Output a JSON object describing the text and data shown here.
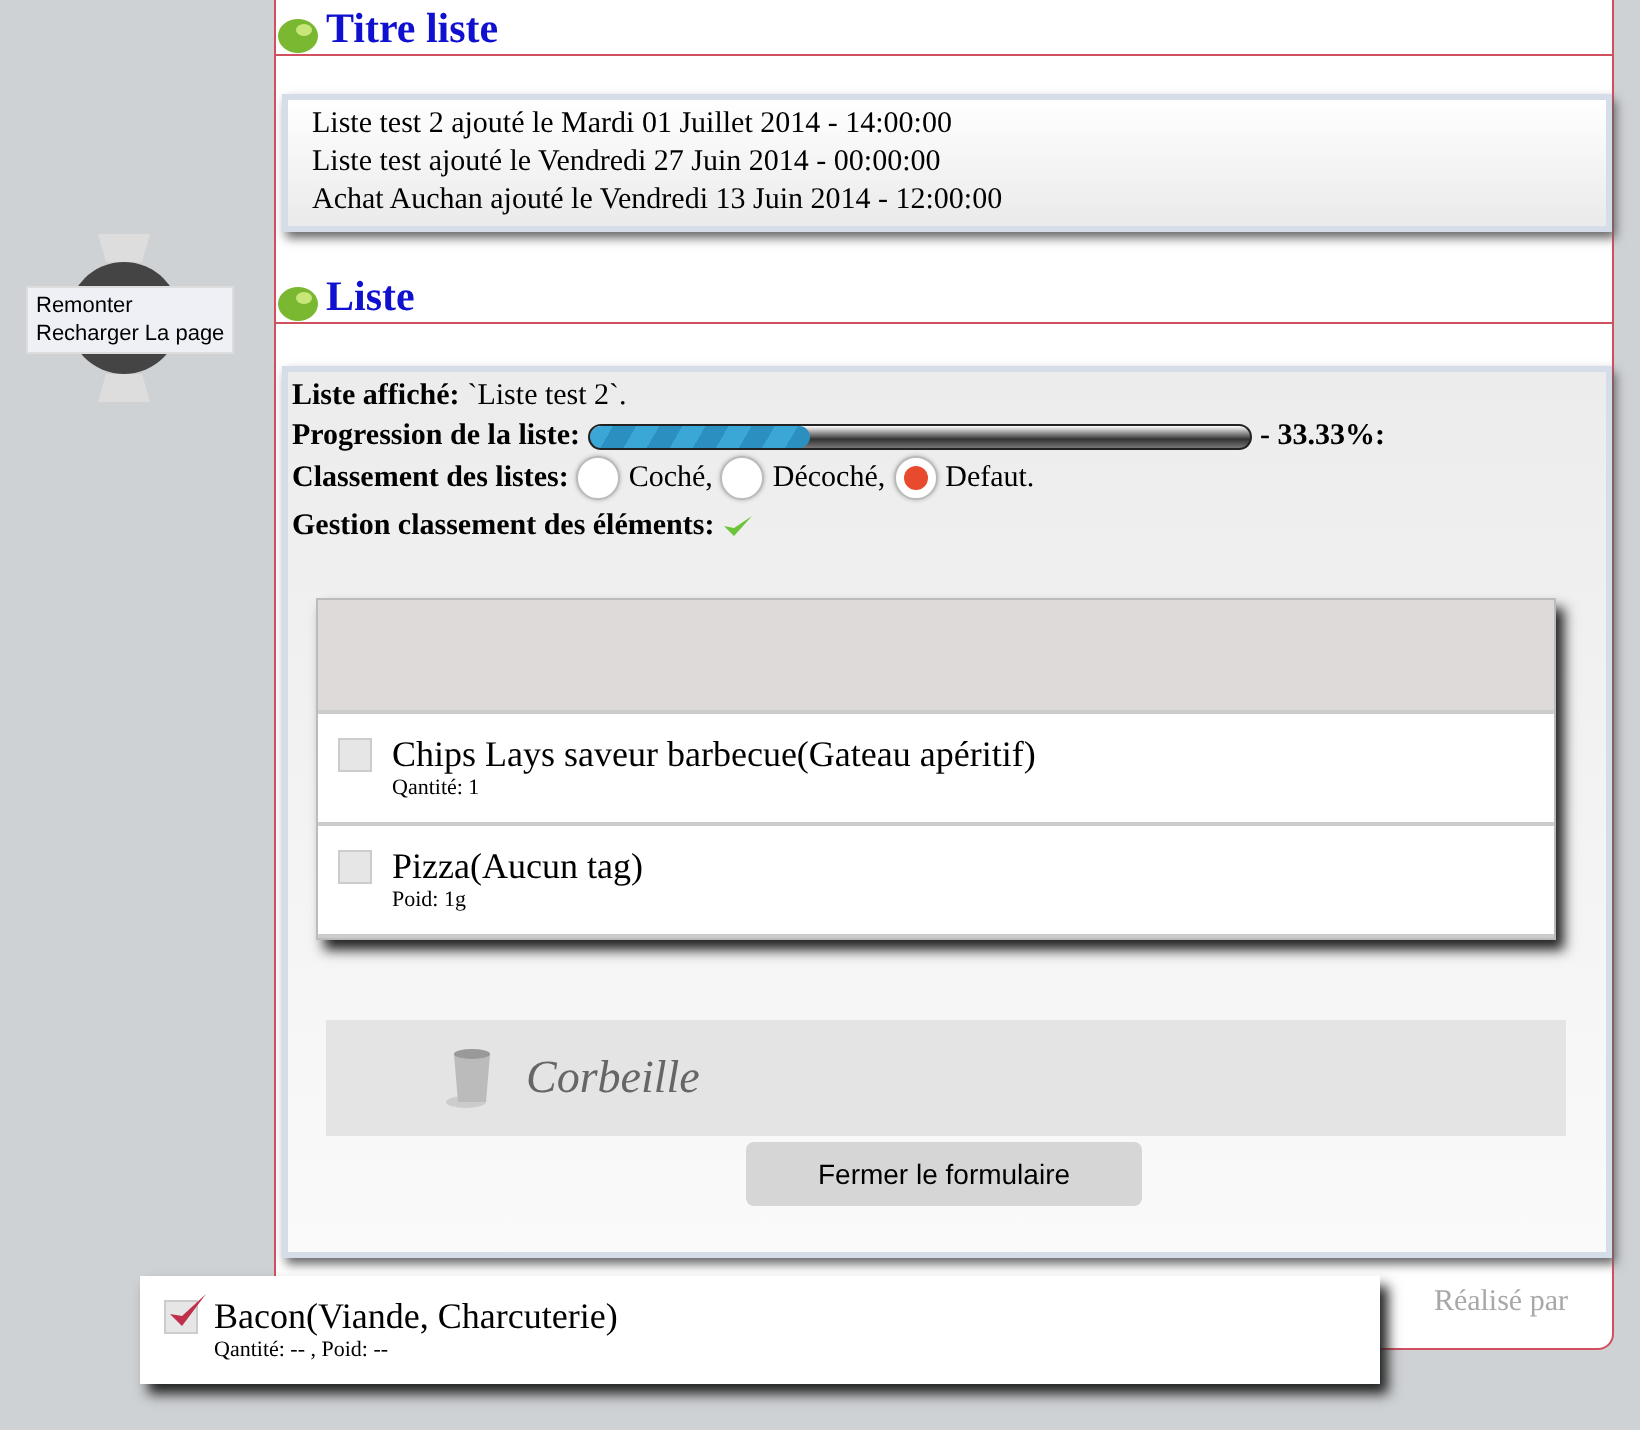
{
  "scroll_widget": {
    "links": [
      "Remonter",
      "Recharger La page"
    ]
  },
  "sections": [
    {
      "title": "Titre liste"
    },
    {
      "title": "Liste"
    }
  ],
  "saved_lists": [
    "Liste test 2 ajouté le Mardi 01 Juillet 2014 - 14:00:00",
    "Liste test ajouté le Vendredi 27 Juin 2014 - 00:00:00",
    "Achat Auchan ajouté le Vendredi 13 Juin 2014 - 12:00:00"
  ],
  "info": {
    "displayed_label": "Liste affiché:",
    "displayed_value": "`Liste test 2`.",
    "progress_label": "Progression de la liste:",
    "progress": {
      "level": 0.3333,
      "reading": "- 33.33%:"
    },
    "sort_label": "Classement des listes:",
    "sort_options": [
      {
        "label": "Coché,",
        "selected": false
      },
      {
        "label": "Décoché,",
        "selected": false
      },
      {
        "label": "Defaut.",
        "selected": true
      }
    ],
    "manage_label": "Gestion classement des éléments:"
  },
  "items": [
    {
      "name": "Chips Lays saveur barbecue(Gateau apéritif)",
      "detail": "Qantité: 1",
      "checked": false
    },
    {
      "name": "Pizza(Aucun tag)",
      "detail": "Poid: 1g",
      "checked": false
    }
  ],
  "trash": {
    "label": "Corbeille"
  },
  "close_button": "Fermer le formulaire",
  "footer": {
    "credit": "Réalisé par"
  },
  "dragged_item": {
    "name": "Bacon(Viande, Charcuterie)",
    "detail": "Qantité: -- , Poid: --",
    "checked": true
  }
}
